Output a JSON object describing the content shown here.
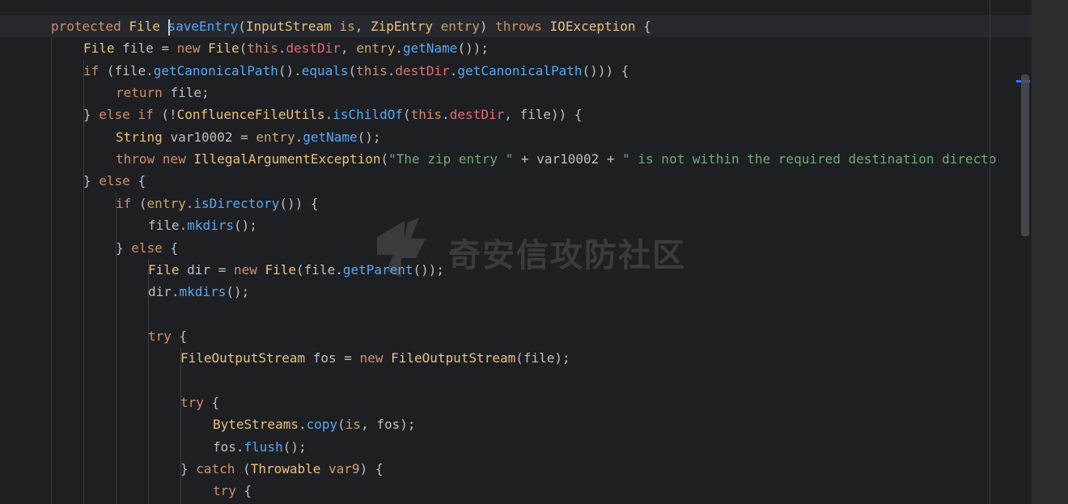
{
  "editor": {
    "lines": [
      [
        [
          "kw",
          "protected "
        ],
        [
          "cls",
          "File "
        ],
        [
          "caret",
          ""
        ],
        [
          "mth",
          "saveEntry"
        ],
        [
          "par",
          "("
        ],
        [
          "cls",
          "InputStream "
        ],
        [
          "ty",
          "is"
        ],
        [
          "par",
          ", "
        ],
        [
          "cls",
          "ZipEntry "
        ],
        [
          "ty",
          "entry"
        ],
        [
          "par",
          ") "
        ],
        [
          "kw",
          "throws "
        ],
        [
          "cls",
          "IOException "
        ],
        [
          "par",
          "{"
        ]
      ],
      [
        [
          "cls",
          "File "
        ],
        [
          "par",
          "file = "
        ],
        [
          "kw",
          "new "
        ],
        [
          "cls",
          "File"
        ],
        [
          "par",
          "("
        ],
        [
          "kw",
          "this"
        ],
        [
          "par",
          "."
        ],
        [
          "fld2",
          "destDir"
        ],
        [
          "par",
          ", "
        ],
        [
          "ty",
          "entry"
        ],
        [
          "par",
          "."
        ],
        [
          "mth",
          "getName"
        ],
        [
          "par",
          "());"
        ]
      ],
      [
        [
          "kw",
          "if "
        ],
        [
          "par",
          "(file."
        ],
        [
          "mth",
          "getCanonicalPath"
        ],
        [
          "par",
          "()."
        ],
        [
          "mth",
          "equals"
        ],
        [
          "par",
          "("
        ],
        [
          "kw",
          "this"
        ],
        [
          "par",
          "."
        ],
        [
          "fld2",
          "destDir"
        ],
        [
          "par",
          "."
        ],
        [
          "mth",
          "getCanonicalPath"
        ],
        [
          "par",
          "())) {"
        ]
      ],
      [
        [
          "kw",
          "return "
        ],
        [
          "par",
          "file;"
        ]
      ],
      [
        [
          "par",
          "} "
        ],
        [
          "kw",
          "else if "
        ],
        [
          "par",
          "(!"
        ],
        [
          "cls",
          "ConfluenceFileUtils"
        ],
        [
          "par",
          "."
        ],
        [
          "mth",
          "isChildOf"
        ],
        [
          "par",
          "("
        ],
        [
          "kw",
          "this"
        ],
        [
          "par",
          "."
        ],
        [
          "fld2",
          "destDir"
        ],
        [
          "par",
          ", file)) {"
        ]
      ],
      [
        [
          "cls",
          "String "
        ],
        [
          "par",
          "var10002 = "
        ],
        [
          "ty",
          "entry"
        ],
        [
          "par",
          "."
        ],
        [
          "mth",
          "getName"
        ],
        [
          "par",
          "();"
        ]
      ],
      [
        [
          "kw",
          "throw new "
        ],
        [
          "cls",
          "IllegalArgumentException"
        ],
        [
          "par",
          "("
        ],
        [
          "str",
          "\"The zip entry \""
        ],
        [
          "par",
          " + var10002 + "
        ],
        [
          "str",
          "\" is not within the required destination directo"
        ]
      ],
      [
        [
          "par",
          "} "
        ],
        [
          "kw",
          "else "
        ],
        [
          "par",
          "{"
        ]
      ],
      [
        [
          "kw",
          "if "
        ],
        [
          "par",
          "("
        ],
        [
          "ty",
          "entry"
        ],
        [
          "par",
          "."
        ],
        [
          "mth",
          "isDirectory"
        ],
        [
          "par",
          "()) {"
        ]
      ],
      [
        [
          "par",
          "file."
        ],
        [
          "mth",
          "mkdirs"
        ],
        [
          "par",
          "();"
        ]
      ],
      [
        [
          "par",
          "} "
        ],
        [
          "kw",
          "else "
        ],
        [
          "par",
          "{"
        ]
      ],
      [
        [
          "cls",
          "File "
        ],
        [
          "par",
          "dir = "
        ],
        [
          "kw",
          "new "
        ],
        [
          "cls",
          "File"
        ],
        [
          "par",
          "(file."
        ],
        [
          "mth",
          "getParent"
        ],
        [
          "par",
          "());"
        ]
      ],
      [
        [
          "par",
          "dir."
        ],
        [
          "mth",
          "mkdirs"
        ],
        [
          "par",
          "();"
        ]
      ],
      [],
      [
        [
          "kw",
          "try "
        ],
        [
          "par",
          "{"
        ]
      ],
      [
        [
          "cls",
          "FileOutputStream "
        ],
        [
          "par",
          "fos = "
        ],
        [
          "kw",
          "new "
        ],
        [
          "cls",
          "FileOutputStream"
        ],
        [
          "par",
          "(file);"
        ]
      ],
      [],
      [
        [
          "kw",
          "try "
        ],
        [
          "par",
          "{"
        ]
      ],
      [
        [
          "cls",
          "ByteStreams"
        ],
        [
          "par",
          "."
        ],
        [
          "mth",
          "copy"
        ],
        [
          "par",
          "("
        ],
        [
          "ty",
          "is"
        ],
        [
          "par",
          ", fos);"
        ]
      ],
      [
        [
          "par",
          "fos."
        ],
        [
          "mth",
          "flush"
        ],
        [
          "par",
          "();"
        ]
      ],
      [
        [
          "par",
          "} "
        ],
        [
          "kw",
          "catch "
        ],
        [
          "par",
          "("
        ],
        [
          "cls",
          "Throwable "
        ],
        [
          "ty",
          "var9"
        ],
        [
          "par",
          ") {"
        ]
      ],
      [
        [
          "kw",
          "try "
        ],
        [
          "par",
          "{"
        ]
      ]
    ],
    "indents": [
      1,
      2,
      2,
      3,
      2,
      3,
      3,
      2,
      3,
      4,
      3,
      4,
      4,
      0,
      4,
      5,
      0,
      5,
      6,
      6,
      5,
      6
    ]
  },
  "watermark": {
    "text": "奇安信攻防社区"
  }
}
